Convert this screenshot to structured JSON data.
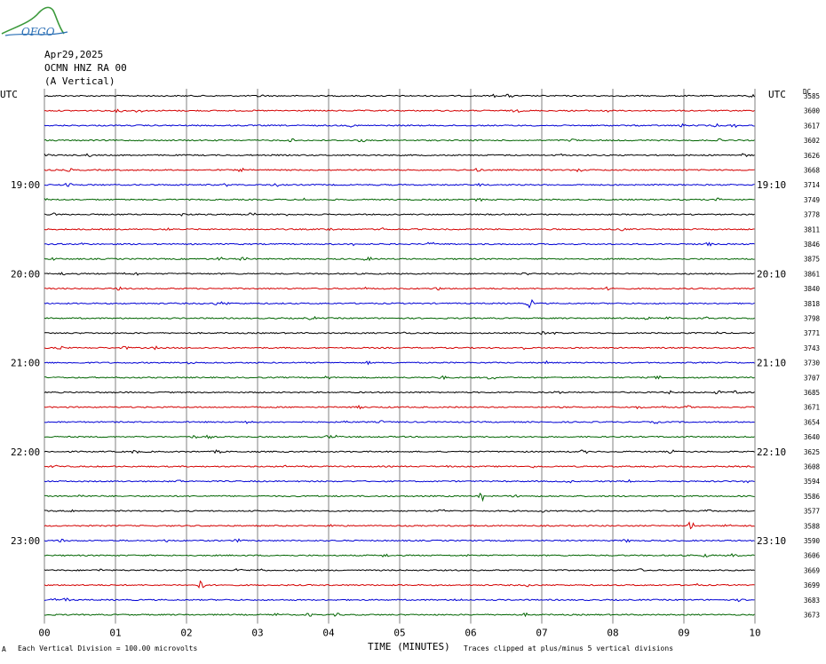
{
  "header": {
    "logo_text": "OFGO",
    "date": "Apr29,2025",
    "station": "OCMN HNZ RA 00",
    "component": "(A Vertical)",
    "left_tz": "UTC",
    "right_tz": "UTC",
    "right_col_label": "DC"
  },
  "footer": {
    "scale_note": "Each Vertical Division =  100.00 microvolts",
    "xlabel": "TIME (MINUTES)",
    "clip_note": "Traces clipped at plus/minus 5 vertical divisions",
    "corner_mark": "A"
  },
  "colors": {
    "trace_cycle": [
      "#000000",
      "#d40000",
      "#0000d4",
      "#006400"
    ],
    "grid": "#808080"
  },
  "chart_data": {
    "type": "line",
    "title": "",
    "xlabel": "TIME (MINUTES)",
    "ylabel": "",
    "x_ticks": [
      "00",
      "01",
      "02",
      "03",
      "04",
      "05",
      "06",
      "07",
      "08",
      "09",
      "10"
    ],
    "xlim": [
      0,
      10
    ],
    "row_minutes": 10,
    "left_time_labels": [
      {
        "row": 6,
        "label": "19:00"
      },
      {
        "row": 12,
        "label": "20:00"
      },
      {
        "row": 18,
        "label": "21:00"
      },
      {
        "row": 24,
        "label": "22:00"
      },
      {
        "row": 30,
        "label": "23:00"
      }
    ],
    "right_time_labels": [
      {
        "row": 6,
        "label": "19:10"
      },
      {
        "row": 12,
        "label": "20:10"
      },
      {
        "row": 18,
        "label": "21:10"
      },
      {
        "row": 24,
        "label": "22:10"
      },
      {
        "row": 30,
        "label": "23:10"
      }
    ],
    "dc_values": [
      "3585",
      "3600",
      "3617",
      "3602",
      "3626",
      "3668",
      "3714",
      "3749",
      "3778",
      "3811",
      "3846",
      "3875",
      "3861",
      "3840",
      "3818",
      "3798",
      "3771",
      "3743",
      "3730",
      "3707",
      "3685",
      "3671",
      "3654",
      "3640",
      "3625",
      "3608",
      "3594",
      "3586",
      "3577",
      "3588",
      "3590",
      "3606",
      "3669",
      "3699",
      "3683",
      "3673"
    ]
  }
}
